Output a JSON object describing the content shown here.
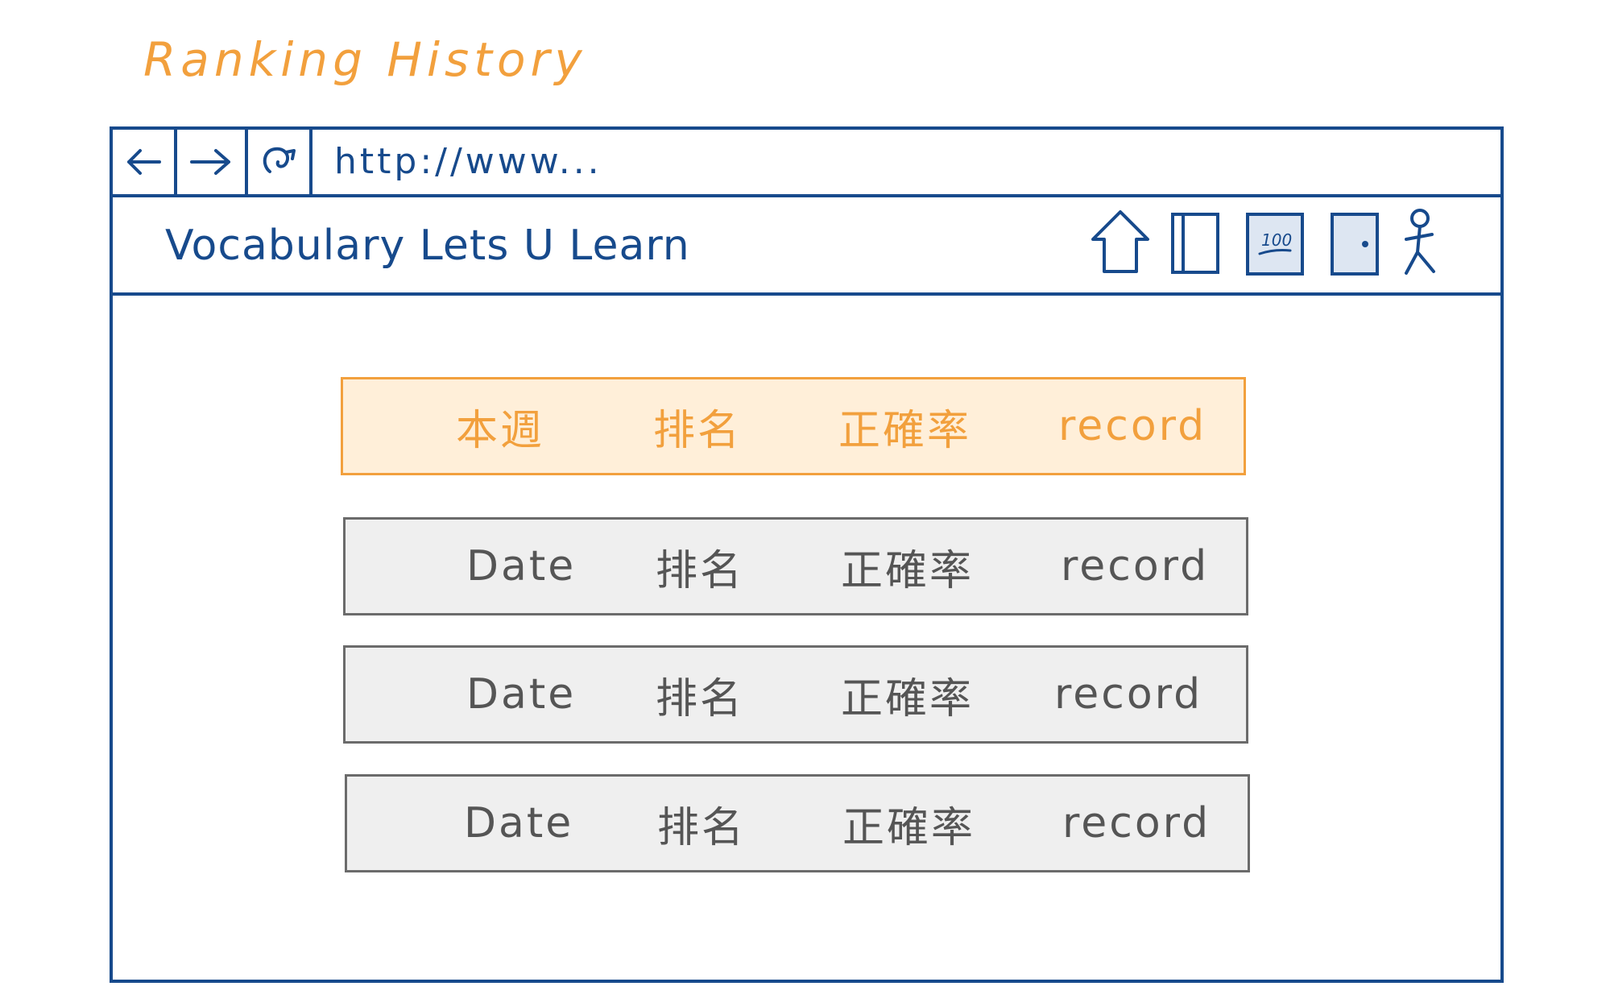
{
  "page": {
    "title": "Ranking History"
  },
  "browser": {
    "url": "http://www..."
  },
  "app": {
    "name": "Vocabulary Lets U Learn",
    "nav_icons": [
      "home-icon",
      "book-icon",
      "score-icon",
      "door-icon",
      "user-icon"
    ],
    "score_icon_text": "100"
  },
  "ranking": {
    "current_week": {
      "period": "本週",
      "rank": "排名",
      "accuracy": "正確率",
      "record": "record"
    },
    "history": [
      {
        "date": "Date",
        "rank": "排名",
        "accuracy": "正確率",
        "record": "record"
      },
      {
        "date": "Date",
        "rank": "排名",
        "accuracy": "正確率",
        "record": "record"
      },
      {
        "date": "Date",
        "rank": "排名",
        "accuracy": "正確率",
        "record": "record"
      }
    ]
  },
  "colors": {
    "primary": "#174a8c",
    "accent": "#f2a03d",
    "row_background": "#efefef",
    "row_border": "#6b6b6b"
  }
}
